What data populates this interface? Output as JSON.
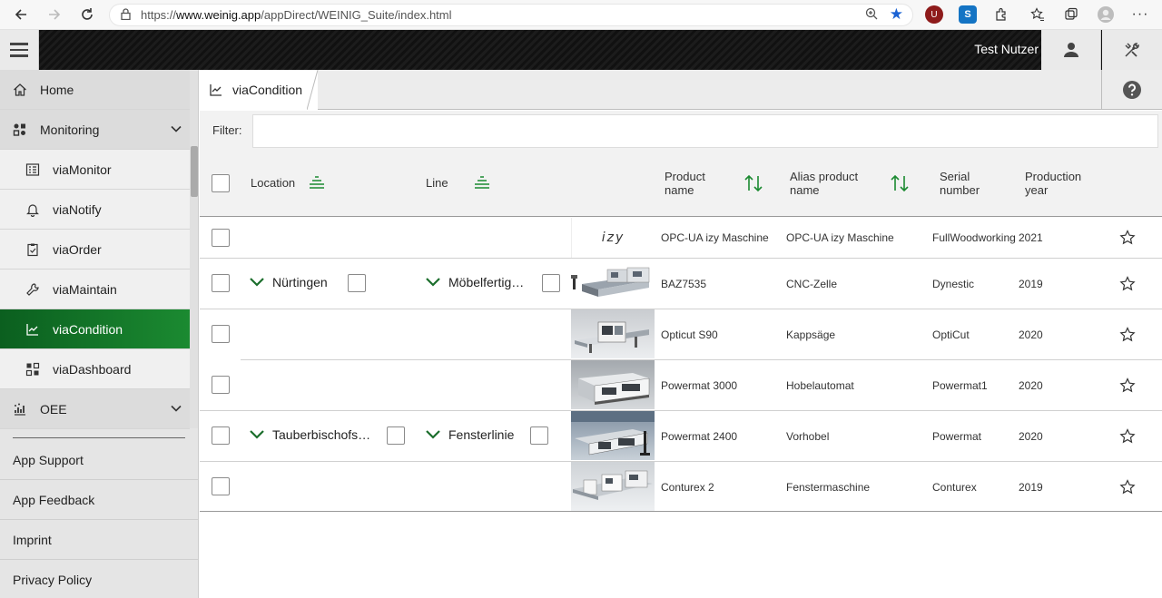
{
  "browser": {
    "url_prefix": "https://",
    "url_host": "www.weinig.app",
    "url_path": "/appDirect/WEINIG_Suite/index.html"
  },
  "header": {
    "user_name": "Test Nutzer"
  },
  "sidebar": {
    "items": [
      {
        "label": "Home",
        "icon": "home-icon"
      },
      {
        "label": "Monitoring",
        "icon": "monitoring-icon"
      },
      {
        "label": "viaMonitor",
        "icon": "monitor-list-icon"
      },
      {
        "label": "viaNotify",
        "icon": "bell-icon"
      },
      {
        "label": "viaOrder",
        "icon": "clipboard-icon"
      },
      {
        "label": "viaMaintain",
        "icon": "wrench-icon"
      },
      {
        "label": "viaCondition",
        "icon": "chart-line-icon"
      },
      {
        "label": "viaDashboard",
        "icon": "dashboard-icon"
      },
      {
        "label": "OEE",
        "icon": "oee-icon"
      }
    ],
    "links": [
      "App Support",
      "App Feedback",
      "Imprint",
      "Privacy Policy"
    ]
  },
  "tab": {
    "label": "viaCondition"
  },
  "filter": {
    "label": "Filter:",
    "value": ""
  },
  "table": {
    "headers": {
      "location": "Location",
      "line": "Line",
      "product_name_1": "Product",
      "product_name_2": "name",
      "alias_1": "Alias product",
      "alias_2": "name",
      "serial_1": "Serial",
      "serial_2": "number",
      "year_1": "Production",
      "year_2": "year"
    },
    "groups": {
      "g1_location": "Nürtingen",
      "g1_line": "Möbelfertig…",
      "g2_location": "Tauberbischofs…",
      "g2_line": "Fensterlinie"
    },
    "izy_logo": "izy",
    "rows": [
      {
        "product": "OPC-UA izy Maschine",
        "alias": "OPC-UA izy Maschine",
        "serial": "FullWoodworking",
        "year": "2021"
      },
      {
        "product": "BAZ7535",
        "alias": "CNC-Zelle",
        "serial": "Dynestic",
        "year": "2019"
      },
      {
        "product": "Opticut S90",
        "alias": "Kappsäge",
        "serial": "OptiCut",
        "year": "2020"
      },
      {
        "product": "Powermat 3000",
        "alias": "Hobelautomat",
        "serial": "Powermat1",
        "year": "2020"
      },
      {
        "product": "Powermat 2400",
        "alias": "Vorhobel",
        "serial": "Powermat",
        "year": "2020"
      },
      {
        "product": "Conturex 2",
        "alias": "Fenstermaschine",
        "serial": "Conturex",
        "year": "2019"
      }
    ]
  },
  "colors": {
    "accent_green": "#1b8a31",
    "header_black": "#111111"
  }
}
